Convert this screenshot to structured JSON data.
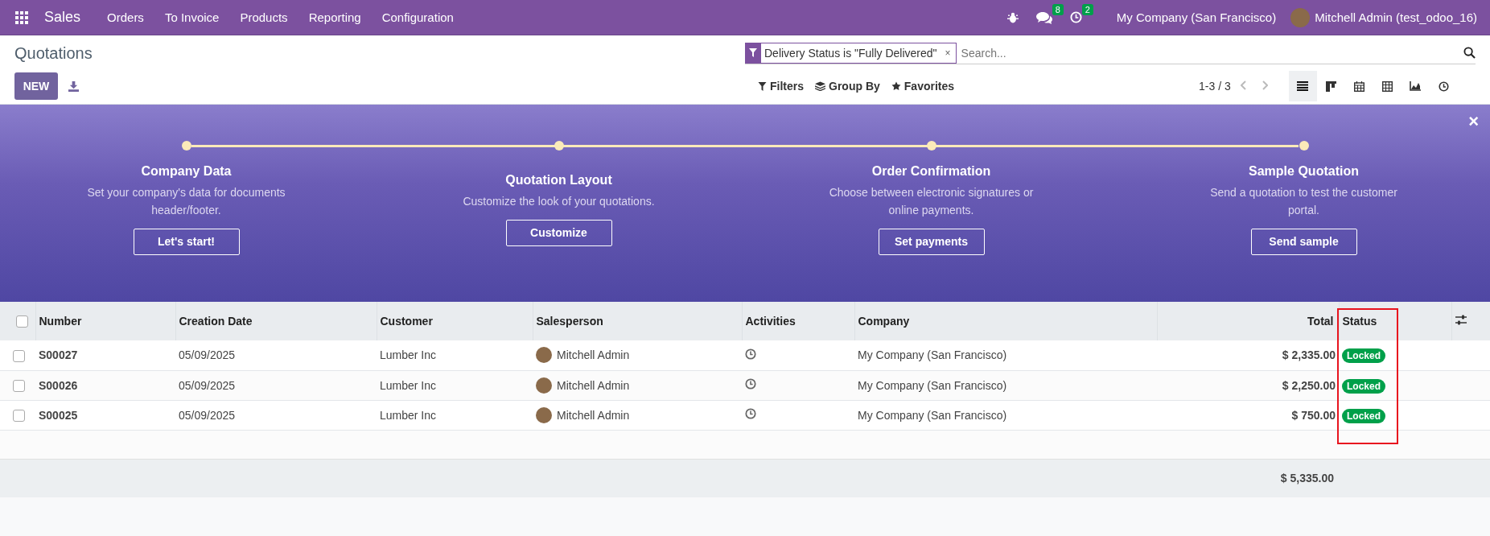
{
  "navbar": {
    "app": "Sales",
    "menu": [
      "Orders",
      "To Invoice",
      "Products",
      "Reporting",
      "Configuration"
    ],
    "chat_count": "8",
    "activity_count": "2",
    "company": "My Company (San Francisco)",
    "user": "Mitchell Admin (test_odoo_16)"
  },
  "page_title": "Quotations",
  "new_button": "NEW",
  "search": {
    "facet": "Delivery Status is \"Fully Delivered\"",
    "facet_remove": "×",
    "placeholder": "Search..."
  },
  "search_options": [
    "Filters",
    "Group By",
    "Favorites"
  ],
  "pager": "1-3 / 3",
  "views": [
    {
      "kind": "list",
      "selected": true
    },
    {
      "kind": "kanban",
      "selected": false
    },
    {
      "kind": "calendar",
      "selected": false
    },
    {
      "kind": "pivot",
      "selected": false
    },
    {
      "kind": "graph",
      "selected": false
    },
    {
      "kind": "activity",
      "selected": false
    }
  ],
  "banner": {
    "close": "×",
    "steps": [
      {
        "title": "Company Data",
        "description": "Set your company's data for documents header/footer.",
        "button": "Let's start!"
      },
      {
        "title": "Quotation Layout",
        "description": "Customize the look of your quotations.",
        "button": "Customize"
      },
      {
        "title": "Order Confirmation",
        "description": "Choose between electronic signatures or online payments.",
        "button": "Set payments"
      },
      {
        "title": "Sample Quotation",
        "description": "Send a quotation to test the customer portal.",
        "button": "Send sample"
      }
    ]
  },
  "table": {
    "select_all_checked": false,
    "columns": [
      {
        "label": "Number",
        "highlighted": false
      },
      {
        "label": "Creation Date",
        "highlighted": false
      },
      {
        "label": "Customer",
        "highlighted": false
      },
      {
        "label": "Salesperson",
        "highlighted": false
      },
      {
        "label": "Activities",
        "highlighted": false
      },
      {
        "label": "Company",
        "highlighted": false
      },
      {
        "label": "Total",
        "highlighted": false
      },
      {
        "label": "Status",
        "highlighted": true
      }
    ],
    "rows": [
      {
        "number": "S00027",
        "date": "05/09/2025",
        "customer": "Lumber Inc",
        "salesperson": "Mitchell Admin",
        "company": "My Company (San Francisco)",
        "total": "$ 2,335.00",
        "status": "Locked",
        "checked": false
      },
      {
        "number": "S00026",
        "date": "05/09/2025",
        "customer": "Lumber Inc",
        "salesperson": "Mitchell Admin",
        "company": "My Company (San Francisco)",
        "total": "$ 2,250.00",
        "status": "Locked",
        "checked": false
      },
      {
        "number": "S00025",
        "date": "05/09/2025",
        "customer": "Lumber Inc",
        "salesperson": "Mitchell Admin",
        "company": "My Company (San Francisco)",
        "total": "$ 750.00",
        "status": "Locked",
        "checked": false
      }
    ],
    "sum_total": "$ 5,335.00"
  }
}
